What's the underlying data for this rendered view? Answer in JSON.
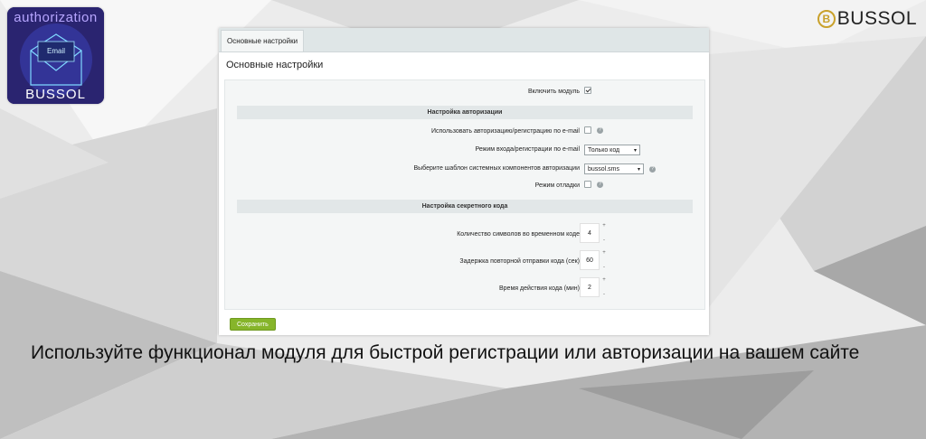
{
  "logo": {
    "top_text": "authorization",
    "bottom_text": "BUSSOL",
    "envelope_text": "Email"
  },
  "brand": {
    "coin": "B",
    "name": "BUSSOL"
  },
  "tab": {
    "label": "Основные настройки"
  },
  "panel_title": "Основные настройки",
  "enable_module": {
    "label": "Включить модуль",
    "checked": true
  },
  "auth_section": {
    "title": "Настройка авторизации"
  },
  "use_email": {
    "label": "Использовать авторизацию/регистрацию по e-mail",
    "checked": false
  },
  "login_mode": {
    "label": "Режим входа/регистрации по e-mail",
    "value": "Только код"
  },
  "template": {
    "label": "Выберите шаблон системных компонентов авторизации",
    "value": "bussol.sms"
  },
  "debug": {
    "label": "Режим отладки",
    "checked": false
  },
  "code_section": {
    "title": "Настройка секретного кода"
  },
  "code_length": {
    "label": "Количество символов во временном коде",
    "value": "4"
  },
  "resend_delay": {
    "label": "Задержка повторной отправки кода (сек)",
    "value": "60"
  },
  "code_ttl": {
    "label": "Время действия кода (мин)",
    "value": "2"
  },
  "save_label": "Сохранить",
  "caption": "Используйте функционал модуля для быстрой регистрации или авторизации на вашем сайте",
  "colors": {
    "save_button": "#86b52a",
    "logo_bg": "#2a2470",
    "coin": "#c9a12b"
  }
}
